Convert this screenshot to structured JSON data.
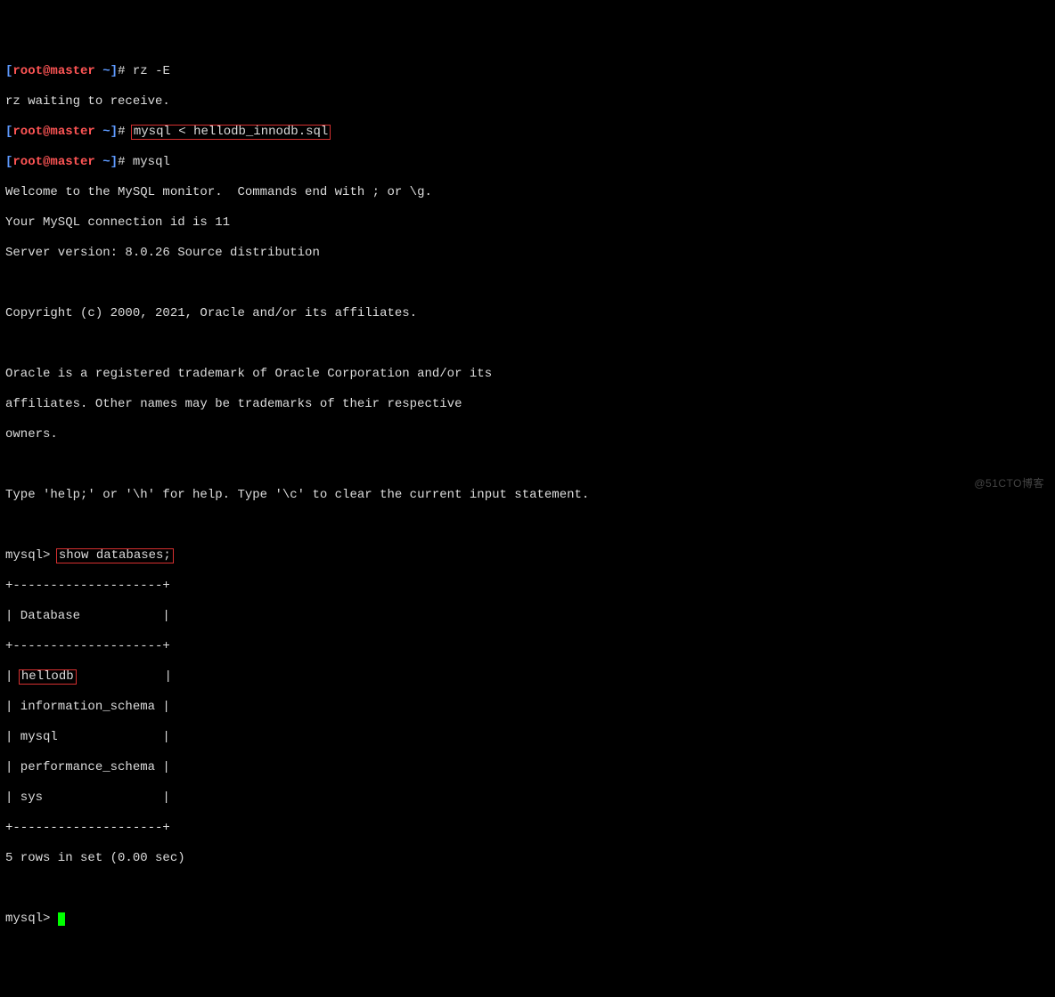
{
  "prompt": {
    "open_br": "[",
    "user": "root",
    "at": "@",
    "host": "master",
    "path": " ~",
    "close_br": "]",
    "hash": "# "
  },
  "cmd": {
    "rz": "rz -E",
    "rz_wait": "rz waiting to receive.",
    "mysql_import": "mysql < hellodb_innodb.sql",
    "mysql": "mysql"
  },
  "banner": {
    "l1": "Welcome to the MySQL monitor.  Commands end with ; or \\g.",
    "l2": "Your MySQL connection id is 11",
    "l3": "Server version: 8.0.26 Source distribution",
    "l4": "Copyright (c) 2000, 2021, Oracle and/or its affiliates.",
    "l5": "Oracle is a registered trademark of Oracle Corporation and/or its",
    "l6": "affiliates. Other names may be trademarks of their respective",
    "l7": "owners.",
    "l8": "Type 'help;' or '\\h' for help. Type '\\c' to clear the current input statement."
  },
  "mysql_prompt": "mysql> ",
  "sql": {
    "show_db": "show databases;"
  },
  "table": {
    "sep": "+--------------------+",
    "header": "| Database           |",
    "rows": {
      "r0_pre": "| ",
      "r0_val": "hellodb",
      "r0_post": "            |",
      "r1": "| information_schema |",
      "r2": "| mysql              |",
      "r3": "| performance_schema |",
      "r4": "| sys                |"
    },
    "footer": "5 rows in set (0.00 sec)"
  },
  "watermark": "@51CTO博客"
}
